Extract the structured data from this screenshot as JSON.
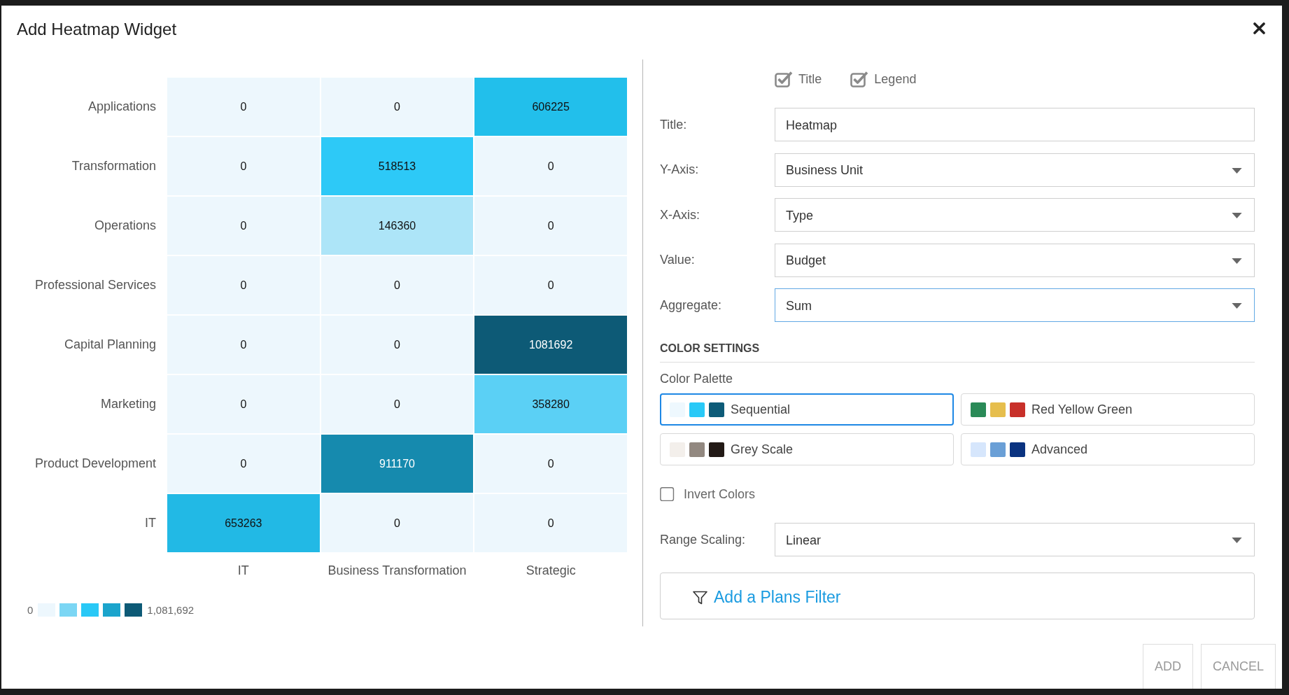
{
  "dialog": {
    "title": "Add Heatmap Widget"
  },
  "heatmap": {
    "rows": [
      {
        "label": "Applications",
        "cells": [
          {
            "value": "0",
            "color": "#edf7fd"
          },
          {
            "value": "0",
            "color": "#edf7fd"
          },
          {
            "value": "606225",
            "color": "#22bfeb"
          }
        ]
      },
      {
        "label": "Transformation",
        "cells": [
          {
            "value": "0",
            "color": "#edf7fd"
          },
          {
            "value": "518513",
            "color": "#2dc9f7"
          },
          {
            "value": "0",
            "color": "#edf7fd"
          }
        ]
      },
      {
        "label": "Operations",
        "cells": [
          {
            "value": "0",
            "color": "#edf7fd"
          },
          {
            "value": "146360",
            "color": "#ade5f8"
          },
          {
            "value": "0",
            "color": "#edf7fd"
          }
        ]
      },
      {
        "label": "Professional Services",
        "cells": [
          {
            "value": "0",
            "color": "#edf7fd"
          },
          {
            "value": "0",
            "color": "#edf7fd"
          },
          {
            "value": "0",
            "color": "#edf7fd"
          }
        ]
      },
      {
        "label": "Capital Planning",
        "cells": [
          {
            "value": "0",
            "color": "#edf7fd"
          },
          {
            "value": "0",
            "color": "#edf7fd"
          },
          {
            "value": "1081692",
            "color": "#0d5a76"
          }
        ]
      },
      {
        "label": "Marketing",
        "cells": [
          {
            "value": "0",
            "color": "#edf7fd"
          },
          {
            "value": "0",
            "color": "#edf7fd"
          },
          {
            "value": "358280",
            "color": "#5bd0f5"
          }
        ]
      },
      {
        "label": "Product Development",
        "cells": [
          {
            "value": "0",
            "color": "#edf7fd"
          },
          {
            "value": "911170",
            "color": "#168aae"
          },
          {
            "value": "0",
            "color": "#edf7fd"
          }
        ]
      },
      {
        "label": "IT",
        "cells": [
          {
            "value": "653263",
            "color": "#22b9e5"
          },
          {
            "value": "0",
            "color": "#edf7fd"
          },
          {
            "value": "0",
            "color": "#edf7fd"
          }
        ]
      }
    ],
    "x_axis": {
      "labels": [
        "IT",
        "Business Transformation",
        "Strategic"
      ]
    }
  },
  "legend": {
    "min": "0",
    "max": "1,081,692",
    "swatches": [
      {
        "color": "#edf7fd"
      },
      {
        "color": "#7bd6f4"
      },
      {
        "color": "#29c8f6"
      },
      {
        "color": "#1ba4cc"
      },
      {
        "color": "#0d5a76"
      }
    ]
  },
  "display_options": [
    {
      "label": "Title",
      "checked": true
    },
    {
      "label": "Legend",
      "checked": true
    }
  ],
  "fields": [
    {
      "label": "Title:",
      "kind": "text",
      "value": "Heatmap",
      "focused": false
    },
    {
      "label": "Y-Axis:",
      "kind": "select",
      "value": "Business Unit",
      "focused": false
    },
    {
      "label": "X-Axis:",
      "kind": "select",
      "value": "Type",
      "focused": false
    },
    {
      "label": "Value:",
      "kind": "select",
      "value": "Budget",
      "focused": false
    },
    {
      "label": "Aggregate:",
      "kind": "select",
      "value": "Sum",
      "focused": true
    }
  ],
  "color_settings": {
    "heading": "COLOR SETTINGS",
    "palette_label": "Color Palette",
    "palettes": [
      {
        "name": "Sequential",
        "selected": true,
        "swatches": [
          {
            "color": "#eef8fe"
          },
          {
            "color": "#29c9f7"
          },
          {
            "color": "#0d5b78"
          }
        ]
      },
      {
        "name": "Red Yellow Green",
        "selected": false,
        "swatches": [
          {
            "color": "#2a8a57"
          },
          {
            "color": "#e6be4d"
          },
          {
            "color": "#c8302a"
          }
        ]
      },
      {
        "name": "Grey Scale",
        "selected": false,
        "swatches": [
          {
            "color": "#f3efeb"
          },
          {
            "color": "#928880"
          },
          {
            "color": "#221a16"
          }
        ]
      },
      {
        "name": "Advanced",
        "selected": false,
        "swatches": [
          {
            "color": "#d6e6fc"
          },
          {
            "color": "#6a9fd6"
          },
          {
            "color": "#0a3380"
          }
        ]
      }
    ],
    "invert_colors": {
      "label": "Invert Colors",
      "checked": false
    },
    "range_scaling": {
      "label": "Range Scaling:",
      "kind": "select",
      "value": "Linear",
      "focused": false
    }
  },
  "filter": {
    "label": "Add a Plans Filter"
  },
  "buttons": [
    {
      "label": "ADD"
    },
    {
      "label": "CANCEL"
    }
  ]
}
